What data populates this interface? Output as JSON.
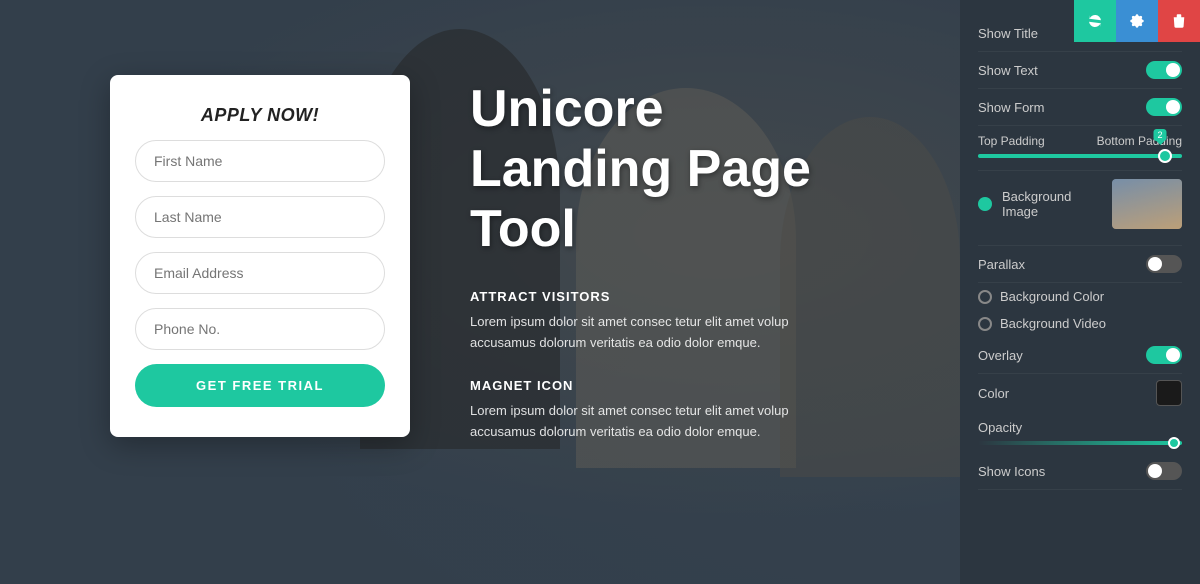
{
  "toolbar": {
    "sync_icon": "⇄",
    "gear_icon": "⚙",
    "trash_icon": "🗑"
  },
  "form": {
    "title": "APPLY NOW!",
    "first_name_placeholder": "First Name",
    "last_name_placeholder": "Last Name",
    "email_placeholder": "Email Address",
    "phone_placeholder": "Phone No.",
    "button_label": "GET FREE TRIAL"
  },
  "hero": {
    "title": "Unicore\nLanding Page Tool",
    "section1_label": "ATTRACT VISITORS",
    "section1_text": "Lorem ipsum dolor sit amet consec tetur elit amet volup accusamus dolorum veritatis ea odio dolor emque.",
    "section2_label": "MAGNET ICON",
    "section2_text": "Lorem ipsum dolor sit amet consec tetur elit amet volup accusamus dolorum veritatis ea odio dolor emque."
  },
  "settings": {
    "show_title_label": "Show Title",
    "show_title_on": true,
    "show_text_label": "Show Text",
    "show_text_on": true,
    "show_form_label": "Show Form",
    "show_form_on": true,
    "top_padding_label": "Top Padding",
    "bottom_padding_label": "Bottom Padding",
    "slider_value": "2",
    "background_image_label": "Background Image",
    "parallax_label": "Parallax",
    "parallax_on": false,
    "background_color_label": "Background Color",
    "background_video_label": "Background Video",
    "overlay_label": "Overlay",
    "overlay_on": true,
    "color_label": "Color",
    "opacity_label": "Opacity",
    "show_icons_label": "Show Icons",
    "show_icons_on": false
  }
}
